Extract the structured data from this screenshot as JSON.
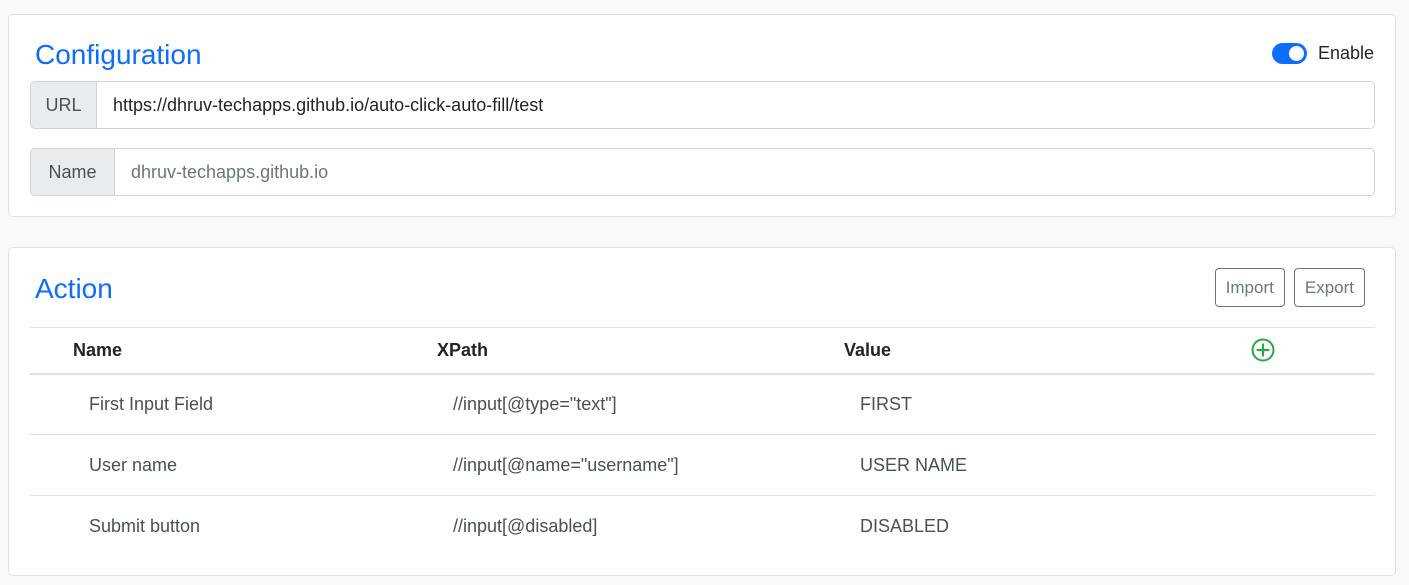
{
  "configuration": {
    "title": "Configuration",
    "enable_label": "Enable",
    "enabled": true,
    "url_label": "URL",
    "url_value": "https://dhruv-techapps.github.io/auto-click-auto-fill/test",
    "name_label": "Name",
    "name_placeholder": "dhruv-techapps.github.io"
  },
  "action": {
    "title": "Action",
    "import_label": "Import",
    "export_label": "Export",
    "columns": [
      "Name",
      "XPath",
      "Value"
    ],
    "rows": [
      {
        "name": "First Input Field",
        "xpath": "//input[@type=\"text\"]",
        "value": "FIRST"
      },
      {
        "name": "User name",
        "xpath": "//input[@name=\"username\"]",
        "value": "USER NAME"
      },
      {
        "name": "Submit button",
        "xpath": "//input[@disabled]",
        "value": "DISABLED"
      }
    ]
  },
  "colors": {
    "primary": "#0d6efd",
    "success": "#28a745",
    "secondary": "#6c757d"
  },
  "icons": {
    "add": "plus-circle-icon"
  }
}
